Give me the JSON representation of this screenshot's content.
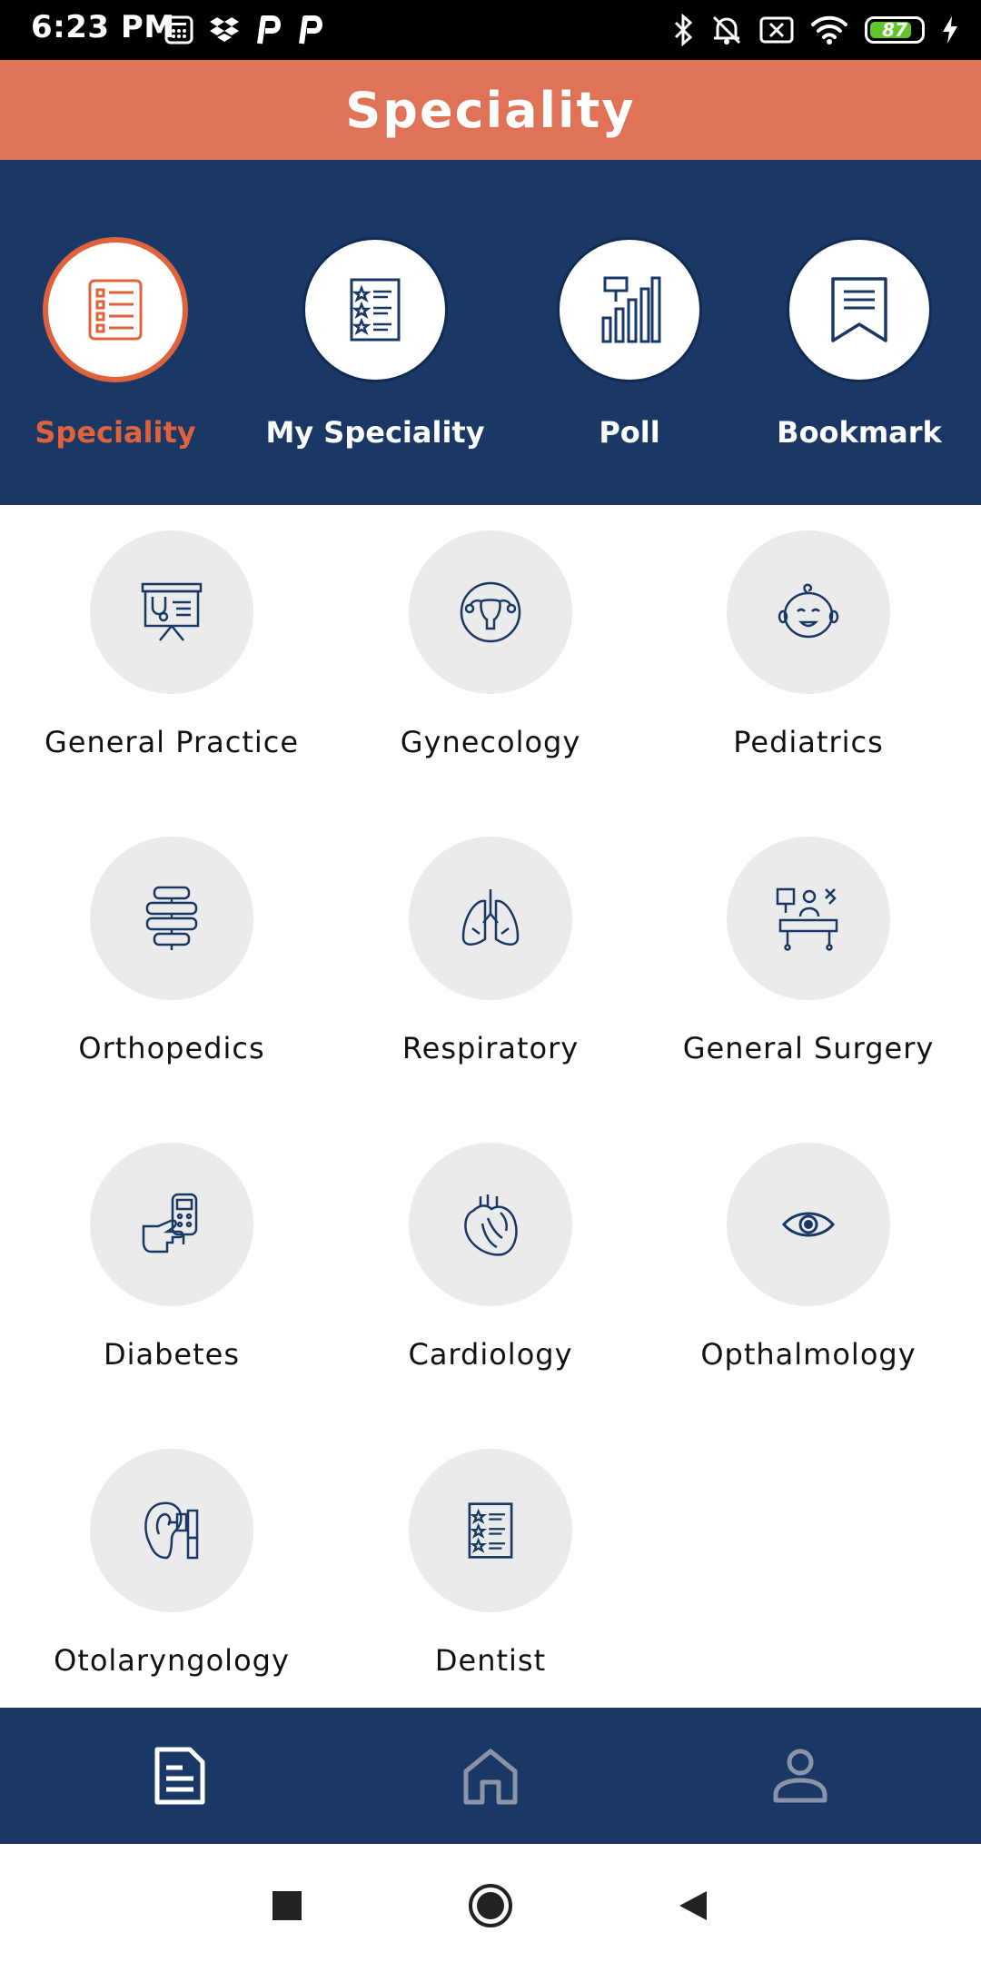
{
  "status_bar": {
    "time": "6:23 PM",
    "battery_level": "87",
    "left_icons": [
      "calculator-icon",
      "dropbox-icon",
      "p-app-icon",
      "p-app-icon"
    ],
    "right_icons": [
      "bluetooth-icon",
      "bell-muted-icon",
      "sim-off-icon",
      "wifi-icon",
      "battery-icon",
      "charging-icon"
    ]
  },
  "header": {
    "title": "Speciality"
  },
  "tabs": [
    {
      "label": "Speciality",
      "icon": "list-document-icon",
      "active": true
    },
    {
      "label": "My Speciality",
      "icon": "star-list-icon",
      "active": false
    },
    {
      "label": "Poll",
      "icon": "bar-chart-icon",
      "active": false
    },
    {
      "label": "Bookmark",
      "icon": "bookmark-icon",
      "active": false
    }
  ],
  "specialities": [
    {
      "label": "General Practice",
      "icon": "presentation-stethoscope-icon"
    },
    {
      "label": "Gynecology",
      "icon": "uterus-icon"
    },
    {
      "label": "Pediatrics",
      "icon": "baby-face-icon"
    },
    {
      "label": "Orthopedics",
      "icon": "spine-icon"
    },
    {
      "label": "Respiratory",
      "icon": "lungs-icon"
    },
    {
      "label": "General Surgery",
      "icon": "surgery-icon"
    },
    {
      "label": "Diabetes",
      "icon": "glucometer-icon"
    },
    {
      "label": "Cardiology",
      "icon": "heart-icon"
    },
    {
      "label": "Opthalmology",
      "icon": "eye-icon"
    },
    {
      "label": "Otolaryngology",
      "icon": "ear-otoscope-icon"
    },
    {
      "label": "Dentist",
      "icon": "star-list-icon"
    }
  ],
  "bottom_nav": [
    {
      "name": "document-icon",
      "active": true
    },
    {
      "name": "home-icon",
      "active": false
    },
    {
      "name": "profile-icon",
      "active": false
    }
  ],
  "colors": {
    "accent": "#e07257",
    "active_tab": "#e0623d",
    "navy": "#1a3866",
    "icon_circle": "#ebebeb"
  }
}
